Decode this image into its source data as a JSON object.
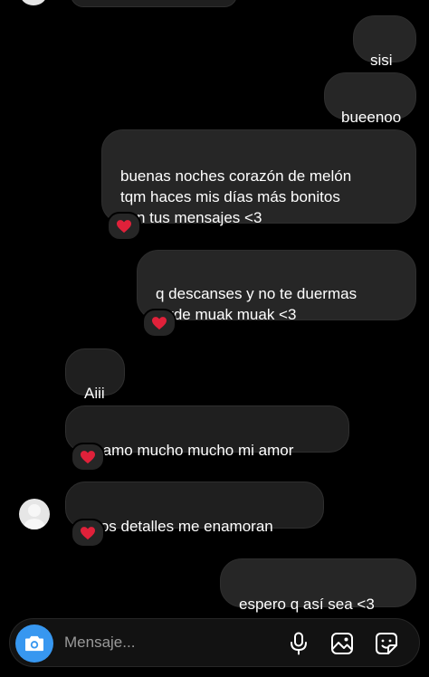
{
  "messages": [
    {
      "text": "sisi",
      "direction": "sent"
    },
    {
      "text": "bueenoo",
      "direction": "sent"
    },
    {
      "text": "buenas noches corazón de melón\ntqm haces mis días más bonitos\ncon tus mensajes <3",
      "direction": "sent",
      "reaction": "❤️"
    },
    {
      "text": "q descanses y no te duermas\ntarde muak muak <3",
      "direction": "sent",
      "reaction": "❤️"
    },
    {
      "text": "Aiii",
      "direction": "received"
    },
    {
      "text": "Te amo mucho mucho mi amor",
      "direction": "received",
      "reaction": "❤️"
    },
    {
      "text": "Esos detalles me enamoran",
      "direction": "received",
      "reaction": "❤️"
    },
    {
      "text": "espero q así sea <3",
      "direction": "sent"
    }
  ],
  "composer": {
    "placeholder": "Mensaje...",
    "icons": [
      "camera-icon",
      "microphone-icon",
      "gallery-icon",
      "sticker-icon"
    ],
    "accent_color": "#3797f0"
  },
  "reaction_color": "#e0213a"
}
